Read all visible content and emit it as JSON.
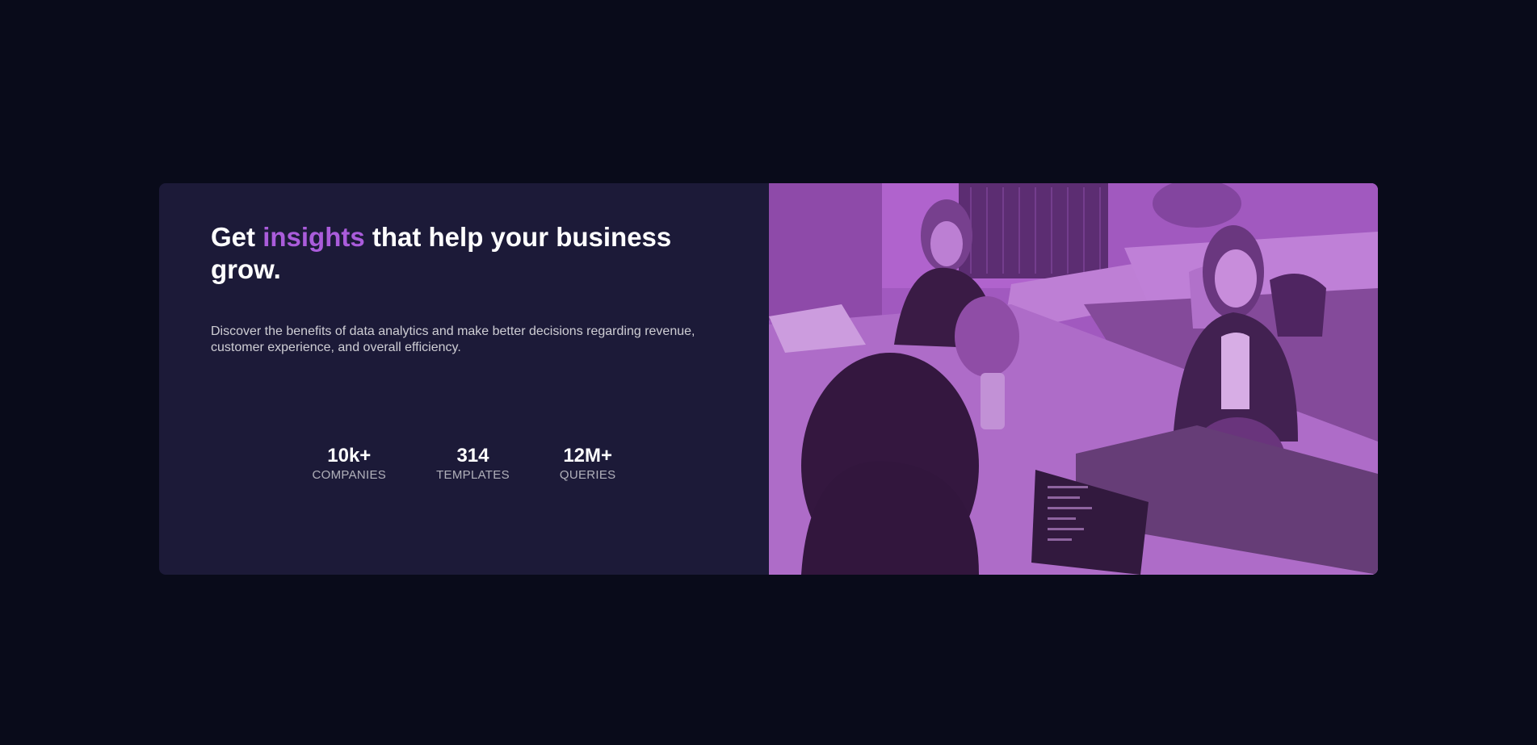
{
  "hero": {
    "headline_before": "Get ",
    "headline_accent": "insights",
    "headline_after": " that help your business grow.",
    "description": "Discover the benefits of data analytics and make better decisions regarding revenue, customer experience, and overall efficiency.",
    "stats": [
      {
        "value": "10k+",
        "label": "COMPANIES"
      },
      {
        "value": "314",
        "label": "TEMPLATES"
      },
      {
        "value": "12M+",
        "label": "QUERIES"
      }
    ],
    "image_subject": "office-team-photo"
  },
  "colors": {
    "page_background": "#090b1a",
    "card_background": "#1c1a38",
    "accent": "#aa5cdb",
    "image_overlay": "#9a55b6"
  }
}
